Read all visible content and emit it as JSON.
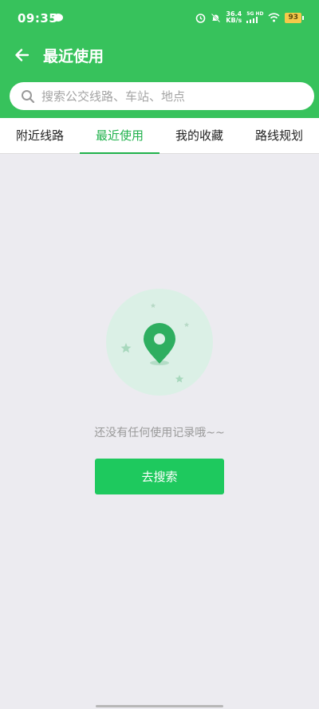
{
  "status_bar": {
    "time": "09:35",
    "net_speed_value": "36.4",
    "net_speed_unit": "KB/s",
    "network_tag": "5G HD",
    "battery": "93"
  },
  "app_bar": {
    "title": "最近使用"
  },
  "search": {
    "placeholder": "搜索公交线路、车站、地点",
    "value": ""
  },
  "tabs": [
    {
      "label": "附近线路",
      "active": false
    },
    {
      "label": "最近使用",
      "active": true
    },
    {
      "label": "我的收藏",
      "active": false
    },
    {
      "label": "路线规划",
      "active": false
    }
  ],
  "empty_state": {
    "message": "还没有任何使用记录哦~~",
    "button_label": "去搜索"
  },
  "colors": {
    "primary": "#37c25c",
    "accent": "#1fb14b",
    "button": "#1ec95e",
    "background": "#ecebf0"
  },
  "icons": [
    "chat-bubble-icon",
    "alarm-icon",
    "mute-bell-icon",
    "signal-icon",
    "wifi-icon",
    "battery-icon",
    "back-arrow-icon",
    "search-icon",
    "location-pin-icon",
    "star-icon"
  ]
}
